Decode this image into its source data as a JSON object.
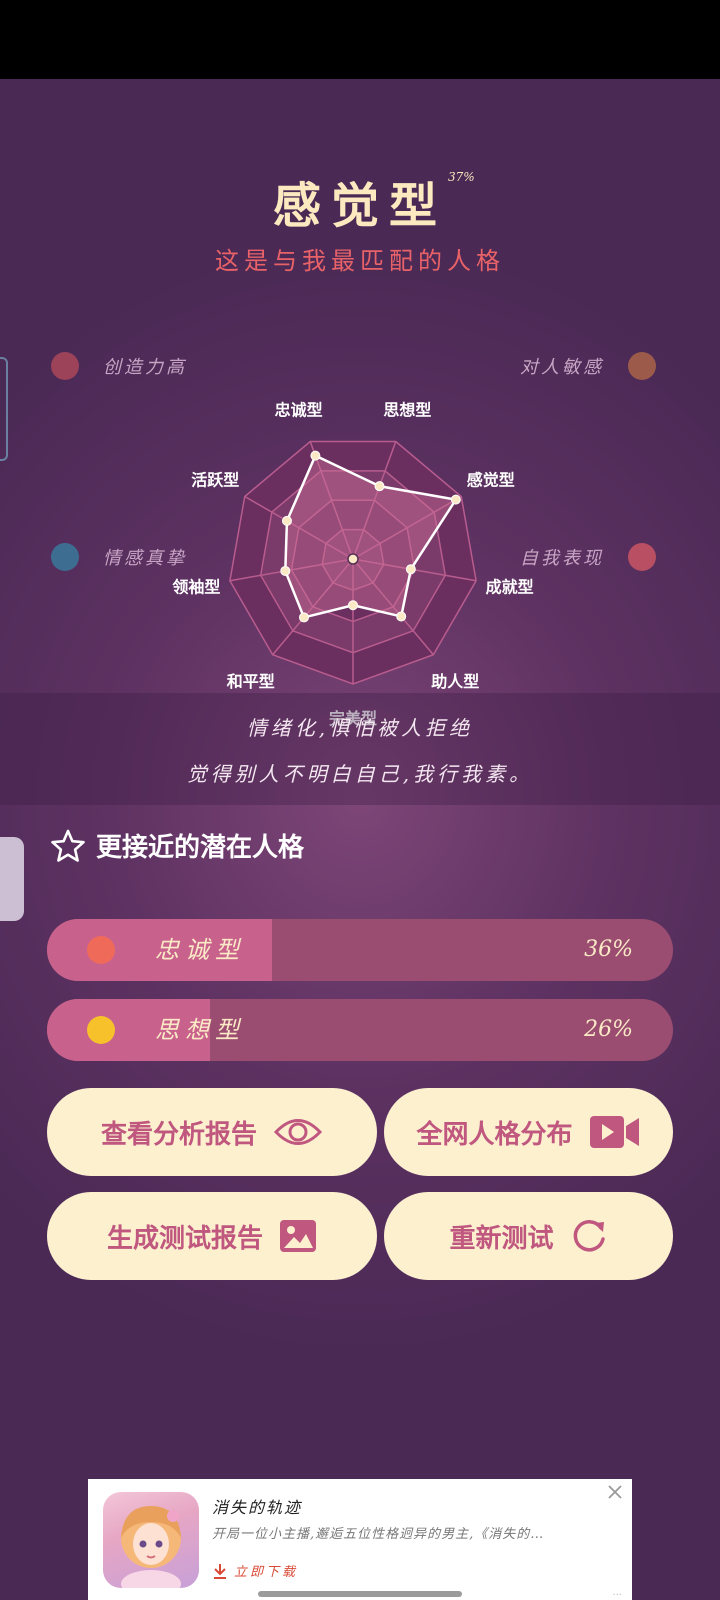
{
  "header": {
    "title": "感觉型",
    "percent": "37%",
    "subtitle": "这是与我最匹配的人格"
  },
  "radar": {
    "labels": [
      "忠诚型",
      "思想型",
      "感觉型",
      "成就型",
      "助人型",
      "完美型",
      "和平型",
      "领袖型",
      "活跃型"
    ],
    "values": [
      0.88,
      0.62,
      0.95,
      0.47,
      0.6,
      0.37,
      0.61,
      0.55,
      0.61
    ],
    "corners": {
      "top_left": "创造力高",
      "top_right": "对人敏感",
      "bottom_left": "情感真挚",
      "bottom_right": "自我表现"
    },
    "colors": {
      "top_left": "#9c4259",
      "top_right": "#9b5a4a",
      "bottom_left": "#3d6e92",
      "bottom_right": "#b84f62"
    }
  },
  "description": {
    "line1": "情绪化,惧怕被人拒绝",
    "line2": "觉得别人不明白自己,我行我素。"
  },
  "potential": {
    "title": "更接近的潜在人格",
    "icon": "star-icon",
    "items": [
      {
        "name": "忠诚型",
        "value": "36%",
        "fill": 0.36,
        "dot_color": "#f06a5a"
      },
      {
        "name": "思想型",
        "value": "26%",
        "fill": 0.26,
        "dot_color": "#f6c12b"
      }
    ]
  },
  "actions": {
    "analysis": "查看分析报告",
    "distribution": "全网人格分布",
    "generate": "生成测试报告",
    "retest": "重新测试"
  },
  "ad": {
    "title": "消失的轨迹",
    "description": "开局一位小主播,邂逅五位性格迥异的男主,《消失的…",
    "cta": "立即下载"
  }
}
